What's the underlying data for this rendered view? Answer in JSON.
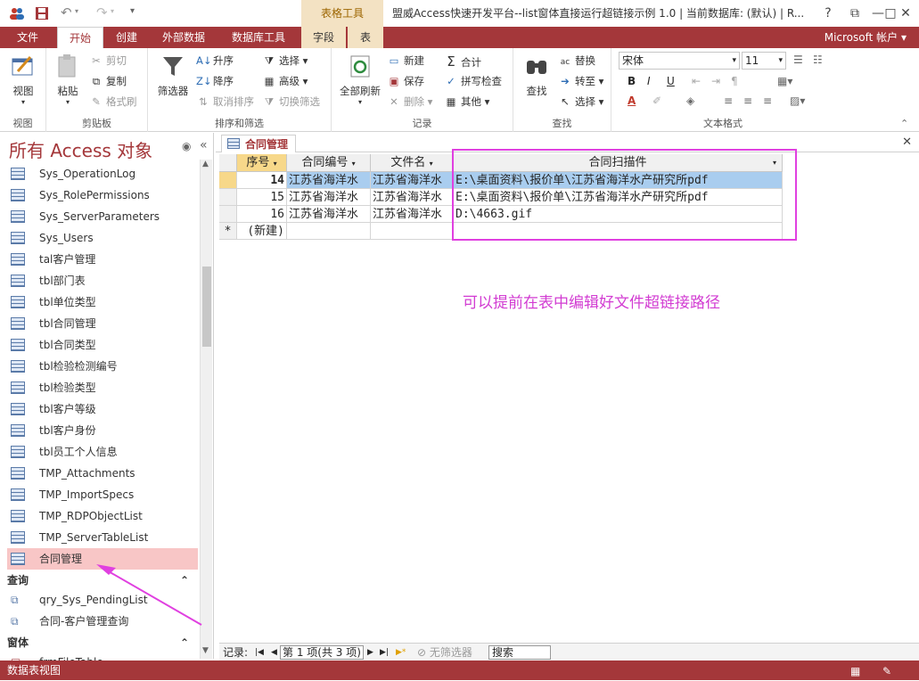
{
  "titlebar": {
    "quick_access": [
      "users-icon",
      "save-icon",
      "undo-icon",
      "redo-icon",
      "customize-icon"
    ],
    "context_group": "表格工具",
    "title": "盟威Access快速开发平台--list窗体直接运行超链接示例 1.0 | 当前数据库: (默认) | R...",
    "buttons": {
      "help": "?",
      "ribbon_opts": "⧉",
      "minimize": "—",
      "maximize": "□",
      "close": "✕"
    }
  },
  "tabs": [
    "文件",
    "开始",
    "创建",
    "外部数据",
    "数据库工具",
    "字段",
    "表"
  ],
  "account": "Microsoft 帐户",
  "ribbon": {
    "view": {
      "label": "视图",
      "group": "视图"
    },
    "clipboard": {
      "paste": "粘贴",
      "cut": "剪切",
      "copy": "复制",
      "format_painter": "格式刷",
      "group": "剪贴板"
    },
    "sort_filter": {
      "filter": "筛选器",
      "asc": "升序",
      "desc": "降序",
      "clear_sort": "取消排序",
      "select": "选择",
      "advanced": "高级",
      "toggle": "切换筛选",
      "group": "排序和筛选"
    },
    "records": {
      "refresh": "全部刷新",
      "new": "新建",
      "save": "保存",
      "delete": "删除",
      "totals": "合计",
      "spelling": "拼写检查",
      "more": "其他",
      "group": "记录"
    },
    "find": {
      "find": "查找",
      "replace": "替换",
      "goto": "转至",
      "select": "选择",
      "group": "查找"
    },
    "text": {
      "font": "宋体",
      "size": "11",
      "bold": "B",
      "italic": "I",
      "underline": "U",
      "group": "文本格式"
    }
  },
  "nav": {
    "title": "所有 Access 对象",
    "tables": [
      "Sys_OperationLog",
      "Sys_RolePermissions",
      "Sys_ServerParameters",
      "Sys_Users",
      "tal客户管理",
      "tbl部门表",
      "tbl单位类型",
      "tbl合同管理",
      "tbl合同类型",
      "tbl检验检测编号",
      "tbl检验类型",
      "tbl客户等级",
      "tbl客户身份",
      "tbl员工个人信息",
      "TMP_Attachments",
      "TMP_ImportSpecs",
      "TMP_RDPObjectList",
      "TMP_ServerTableList",
      "合同管理"
    ],
    "queries_header": "查询",
    "queries": [
      "qry_Sys_PendingList",
      "合同-客户管理查询"
    ],
    "forms_header": "窗体",
    "forms": [
      "frmFileTable"
    ]
  },
  "doc_tab": "合同管理",
  "grid": {
    "columns": [
      "序号",
      "合同编号",
      "文件名",
      "合同扫描件"
    ],
    "rows": [
      {
        "id": "14",
        "no": "江苏省海洋水",
        "name": "江苏省海洋水",
        "scan": "E:\\桌面资料\\报价单\\江苏省海洋水产研究所pdf"
      },
      {
        "id": "15",
        "no": "江苏省海洋水",
        "name": "江苏省海洋水",
        "scan": "E:\\桌面资料\\报价单\\江苏省海洋水产研究所pdf"
      },
      {
        "id": "16",
        "no": "江苏省海洋水",
        "name": "江苏省海洋水",
        "scan": "D:\\4663.gif"
      }
    ],
    "new_row_marker": "*",
    "new_row_label": "(新建)"
  },
  "note": "可以提前在表中编辑好文件超链接路径",
  "record_nav": {
    "label": "记录:",
    "position": "第 1 项(共 3 项)",
    "filter": "无筛选器",
    "search": "搜索"
  },
  "status": {
    "left": "数据表视图"
  }
}
